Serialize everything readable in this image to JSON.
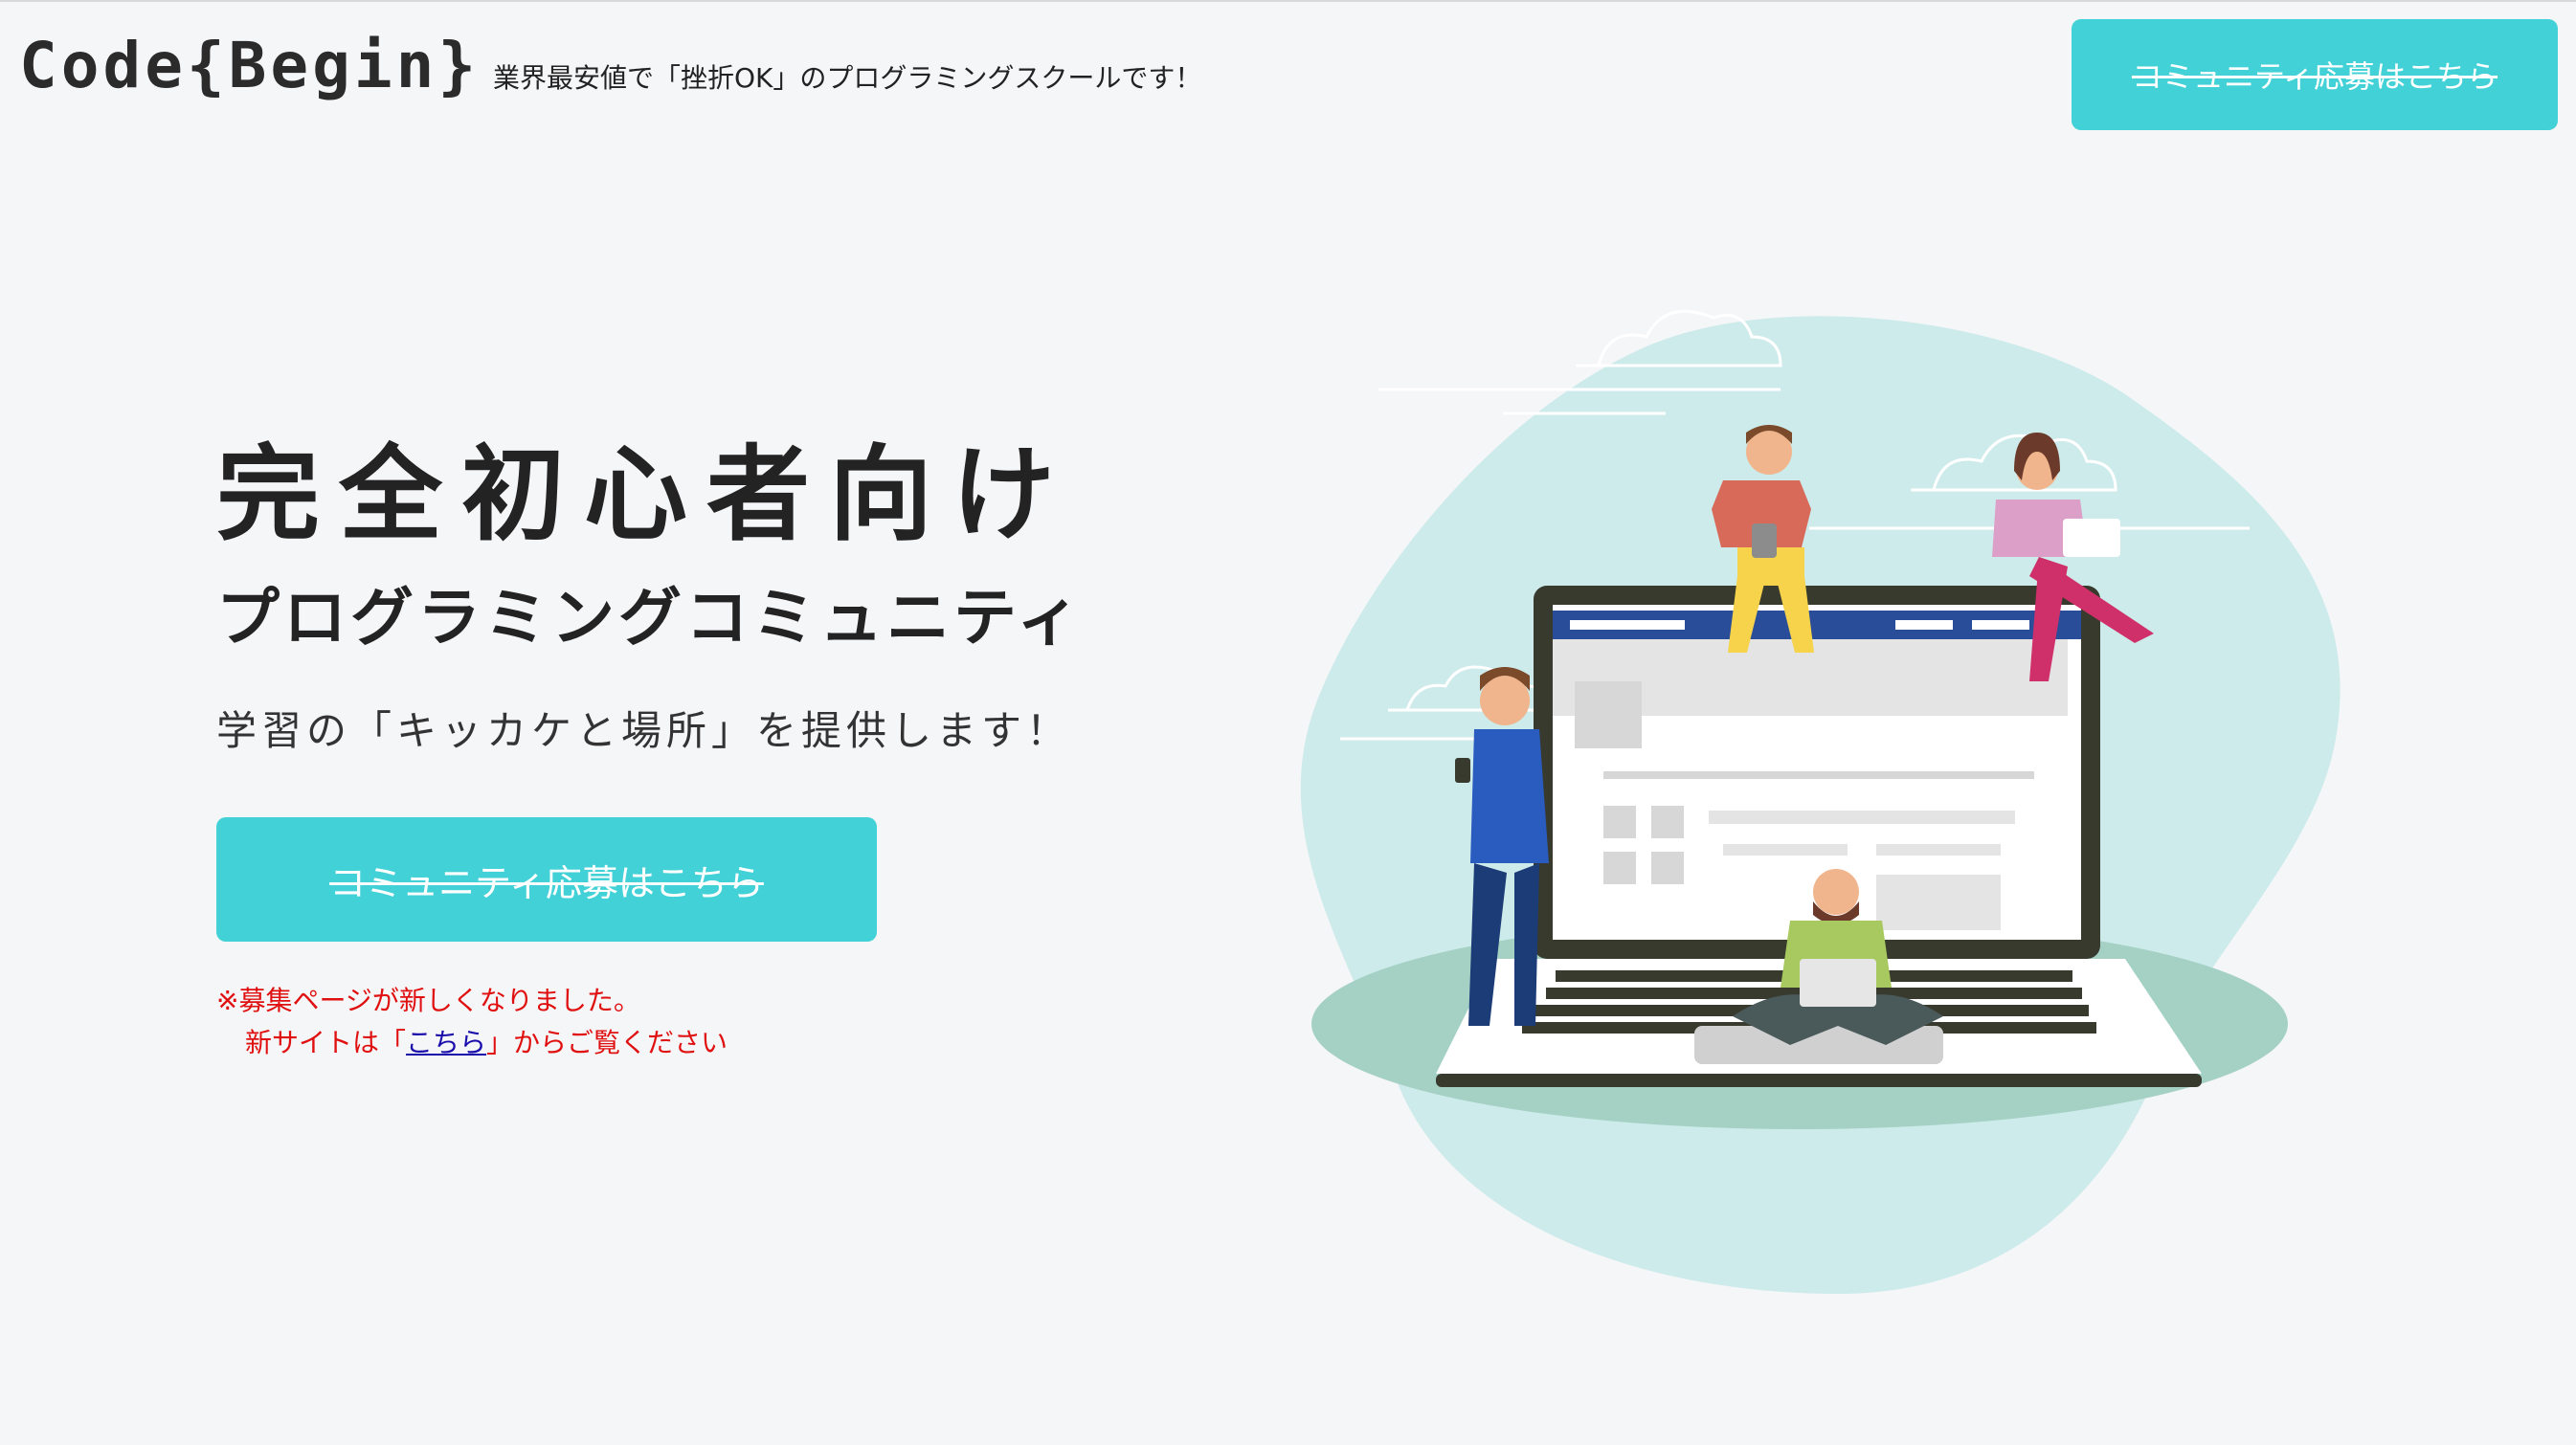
{
  "header": {
    "logo": "Code{Begin}",
    "tagline": "業界最安値で「挫折OK」のプログラミングスクールです！",
    "cta_label": "コミュニティ応募はこちら"
  },
  "hero": {
    "title": "完全初心者向け",
    "subtitle": "プログラミングコミュニティ",
    "description": "学習の「キッカケと場所」を提供します！",
    "cta_label": "コミュニティ応募はこちら"
  },
  "notice": {
    "line1": "※募集ページが新しくなりました。",
    "line2_prefix": "新サイトは「",
    "link_label": "こちら",
    "line2_suffix": "」からご覧ください"
  },
  "colors": {
    "accent": "#41d1d6",
    "notice": "#e01010",
    "link": "#1a0dab"
  }
}
